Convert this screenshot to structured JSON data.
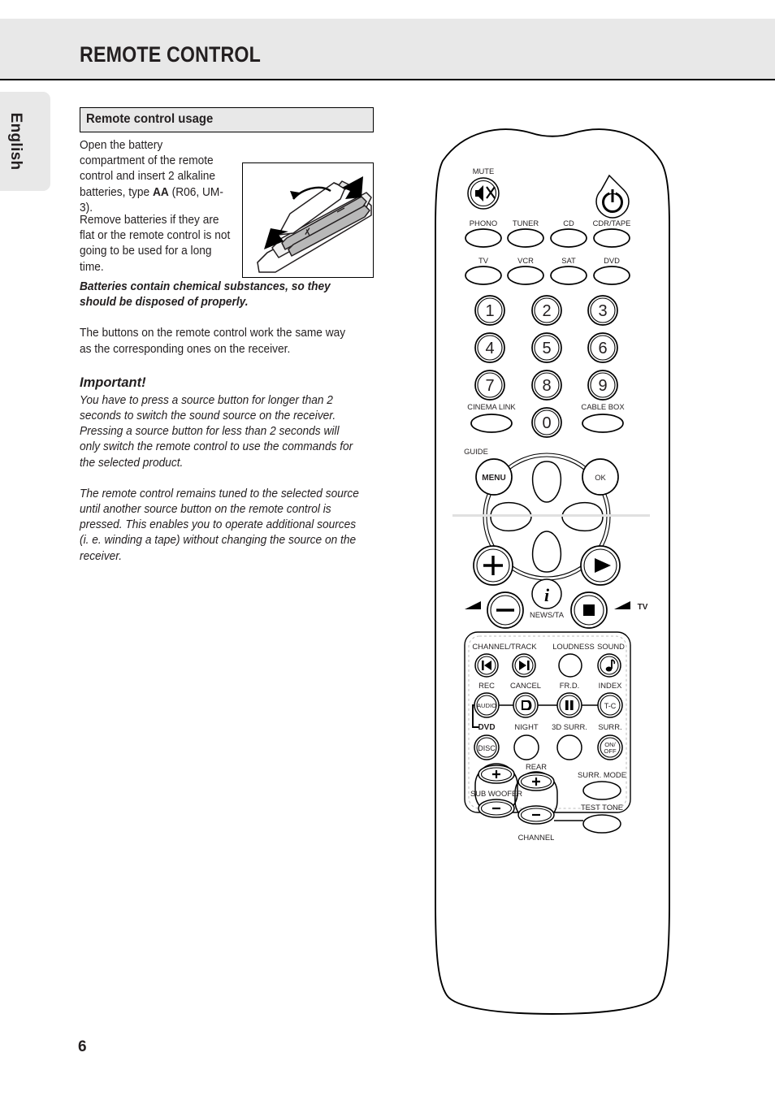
{
  "header": {
    "title": "REMOTE CONTROL"
  },
  "sidebar": {
    "language_tab": "English"
  },
  "page": {
    "number": "6"
  },
  "usage_box": {
    "title": "Remote control usage"
  },
  "content": {
    "intro_para_1_a": "Open the battery compartment of the remote control and insert 2 alkaline batteries, type ",
    "intro_para_1_bold": "AA",
    "intro_para_1_b": " (R06, UM-3).",
    "intro_para_2": "Remove batteries if they are flat or the remote control is not going to be used for a long time.",
    "warning": "Batteries contain chemical substances, so they should be disposed of properly.",
    "buttons_note": "The buttons on the remote control work the same way as the corresponding ones on the receiver.",
    "important_heading": "Important!",
    "important_para": "You have to press a source button for longer than 2 seconds to switch the sound source on the receiver. Pressing a source button for less than 2 seconds will only switch the remote control to use the commands for the selected product.",
    "tuned_para": "The remote control remains tuned to the selected source until another source button on the remote control is pressed. This enables you to operate additional sources (i. e. winding a tape) without changing the source on the receiver."
  },
  "figure": {
    "battery_illustration": "battery-compartment-illustration",
    "remote_illustration": "remote-control-illustration"
  },
  "remote": {
    "mute_label": "MUTE",
    "standby_icon": "power-standby-icon",
    "mute_icon": "mute-speaker-icon",
    "source_row_1": [
      "PHONO",
      "TUNER",
      "CD",
      "CDR/TAPE"
    ],
    "source_row_2": [
      "TV",
      "VCR",
      "SAT",
      "DVD"
    ],
    "numeric_keys": [
      "1",
      "2",
      "3",
      "4",
      "5",
      "6",
      "7",
      "8",
      "9",
      "0"
    ],
    "cinema_link_label": "CINEMA LINK",
    "cable_box_label": "CABLE BOX",
    "guide_label": "GUIDE",
    "menu_label": "MENU",
    "ok_label": "OK",
    "news_ta_label": "NEWS/TA",
    "info_icon": "info-i-icon",
    "volume_up_icon": "plus-icon",
    "volume_down_icon": "minus-icon",
    "play_icon": "play-triangle-icon",
    "stop_icon": "stop-square-icon",
    "volume_label": "volume-wedge-icon",
    "tv_label": "TV",
    "panel": {
      "row1_labels": [
        "CHANNEL/TRACK",
        "LOUDNESS",
        "SOUND"
      ],
      "row1_icons": [
        "prev-track-icon",
        "next-track-icon",
        "loudness-blank-icon",
        "sound-note-icon"
      ],
      "row2_labels": [
        "REC",
        "CANCEL",
        "FR.D.",
        "INDEX"
      ],
      "row2_keys": [
        "AUDIO",
        "cancel-diamond-icon",
        "pause-icon",
        "T-C"
      ],
      "row3_labels": [
        "DVD",
        "NIGHT",
        "3D SURR.",
        "SURR."
      ],
      "row3_keys": [
        "DISC",
        "",
        "",
        "ON/\nOFF"
      ],
      "on_off_line_1": "ON/",
      "on_off_line_2": "OFF",
      "rear_label": "REAR",
      "sub_woofer_label": "SUB WOOFER",
      "channel_label": "CHANNEL",
      "surr_mode_label": "SURR. MODE",
      "test_tone_label": "TEST TONE",
      "plus": "+",
      "minus": "−"
    }
  }
}
